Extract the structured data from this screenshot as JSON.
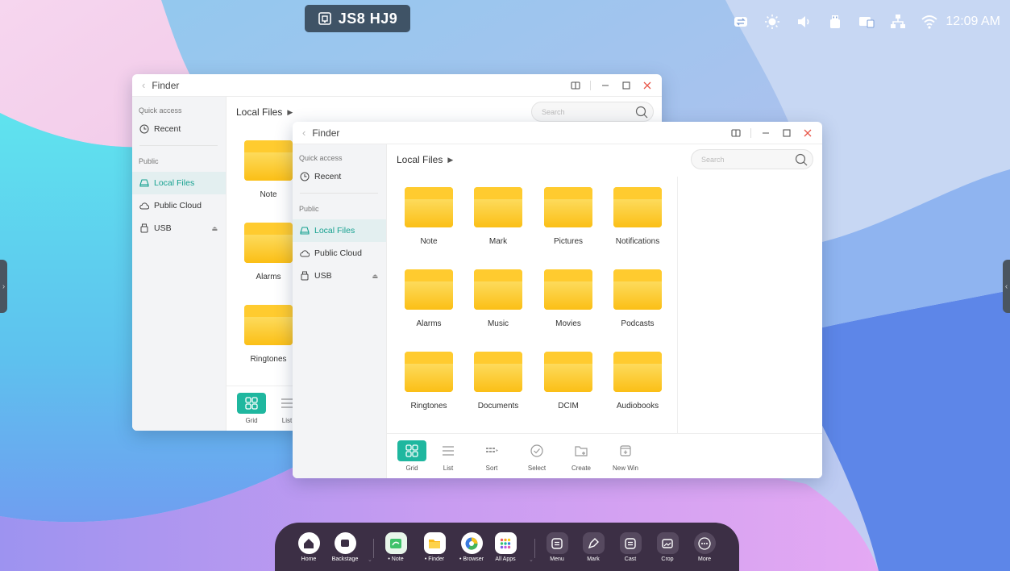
{
  "device_code": "JS8 HJ9",
  "status_bar": {
    "icons": [
      "cast-switch-icon",
      "brightness-icon",
      "volume-icon",
      "usb-drive-icon",
      "display-source-icon",
      "ethernet-icon",
      "wifi-icon"
    ],
    "time": "12:09 AM"
  },
  "finder_back": {
    "title": "Finder",
    "sidebar": {
      "quick_access_label": "Quick access",
      "recent_label": "Recent",
      "public_label": "Public",
      "local_files_label": "Local Files",
      "public_cloud_label": "Public Cloud",
      "usb_label": "USB"
    },
    "breadcrumb": "Local Files",
    "search_placeholder": "Search",
    "folders": [
      "Note",
      "Alarms",
      "Ringtones"
    ],
    "toolbar": {
      "grid_label": "Grid",
      "list_label": "List"
    }
  },
  "finder_front": {
    "title": "Finder",
    "sidebar": {
      "quick_access_label": "Quick access",
      "recent_label": "Recent",
      "public_label": "Public",
      "local_files_label": "Local Files",
      "public_cloud_label": "Public Cloud",
      "usb_label": "USB"
    },
    "breadcrumb": "Local Files",
    "search_placeholder": "Search",
    "folders": [
      "Note",
      "Mark",
      "Pictures",
      "Notifications",
      "Alarms",
      "Music",
      "Movies",
      "Podcasts",
      "Ringtones",
      "Documents",
      "DCIM",
      "Audiobooks"
    ],
    "toolbar": {
      "grid_label": "Grid",
      "list_label": "List",
      "sort_label": "Sort",
      "select_label": "Select",
      "create_label": "Create",
      "new_win_label": "New Win"
    }
  },
  "dock": {
    "home": "Home",
    "backstage": "Backstage",
    "note": "• Note",
    "finder": "• Finder",
    "browser": "• Browser",
    "all_apps": "All Apps",
    "menu": "Menu",
    "mark": "Mark",
    "cast": "Cast",
    "crop": "Crop",
    "more": "More"
  },
  "colors": {
    "accent": "#1fb79f",
    "folder": "#fbc21b",
    "dock_bg": "#3c2f45",
    "code_pill": "#3f5366"
  }
}
